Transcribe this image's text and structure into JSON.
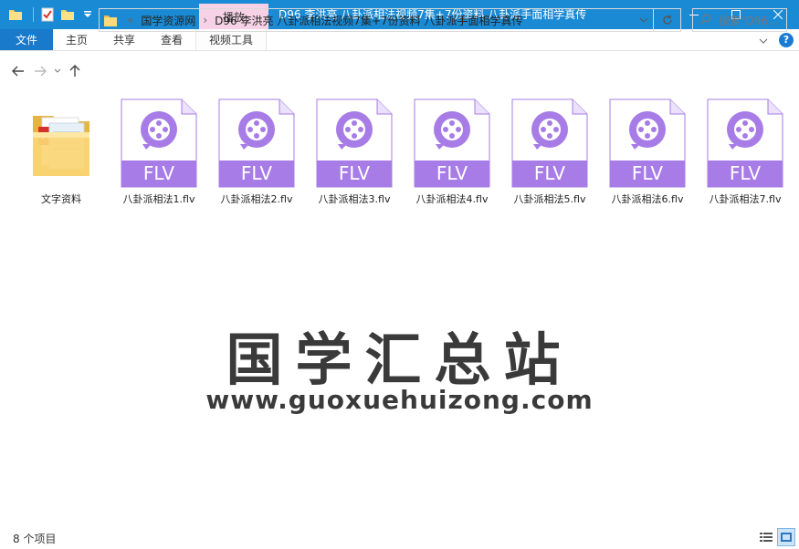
{
  "window": {
    "title": "D96 李洪亮 八卦派相法视频7集+7份资料 八卦派手面相学真传",
    "context_tab": "播放"
  },
  "ribbon": {
    "tabs": [
      "文件",
      "主页",
      "共享",
      "查看",
      "视频工具"
    ]
  },
  "address": {
    "overflow": "«",
    "crumbs": [
      "国学资源网",
      "D96 李洪亮 八卦派相法视频7集+7份资料 八卦派手面相学真传"
    ]
  },
  "search": {
    "placeholder": "搜索\"D96..."
  },
  "files": [
    {
      "name": "文字资料",
      "type": "folder"
    },
    {
      "name": "八卦派相法1.flv",
      "type": "flv",
      "badge": "FLV"
    },
    {
      "name": "八卦派相法2.flv",
      "type": "flv",
      "badge": "FLV"
    },
    {
      "name": "八卦派相法3.flv",
      "type": "flv",
      "badge": "FLV"
    },
    {
      "name": "八卦派相法4.flv",
      "type": "flv",
      "badge": "FLV"
    },
    {
      "name": "八卦派相法5.flv",
      "type": "flv",
      "badge": "FLV"
    },
    {
      "name": "八卦派相法6.flv",
      "type": "flv",
      "badge": "FLV"
    },
    {
      "name": "八卦派相法7.flv",
      "type": "flv",
      "badge": "FLV"
    }
  ],
  "watermark": {
    "title": "国学汇总站",
    "url": "www.guoxuehuizong.com"
  },
  "status": {
    "count": "8 个项目"
  },
  "colors": {
    "titlebar": "#1a8ad4",
    "file_tab": "#1979ca",
    "context_tab": "#f7d2e6",
    "flv_purple": "#a77ce6"
  }
}
